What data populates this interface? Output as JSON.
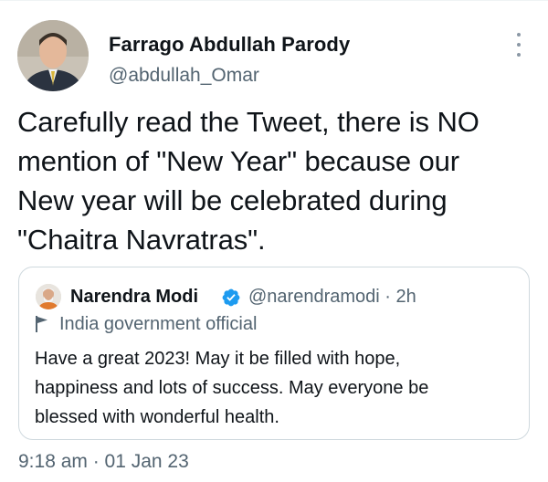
{
  "tweet": {
    "author": {
      "display_name": "Farrago Abdullah Parody",
      "handle": "@abdullah_Omar",
      "avatar_icon": "profile-photo"
    },
    "more_icon": "more-options-icon",
    "text_lines": [
      "Carefully read the Tweet, there is NO",
      "mention of \"New Year\" because our",
      "New year will be celebrated during",
      "\"Chaitra Navratras\"."
    ],
    "timestamp": "9:18 am · 01 Jan 23"
  },
  "quoted_tweet": {
    "author": {
      "display_name": "Narendra Modi",
      "verified_icon": "verified-badge-icon",
      "handle_and_time": "@narendramodi · 2h",
      "avatar_icon": "profile-photo"
    },
    "label_icon": "flag-icon",
    "label": "India government official",
    "text_lines": [
      "Have a great 2023! May it be filled with hope,",
      "happiness and lots of success. May everyone be",
      "blessed with wonderful health."
    ]
  },
  "colors": {
    "text_primary": "#0f1419",
    "text_secondary": "#536471",
    "border": "#cfd9de",
    "verified_blue": "#1d9bf0"
  }
}
